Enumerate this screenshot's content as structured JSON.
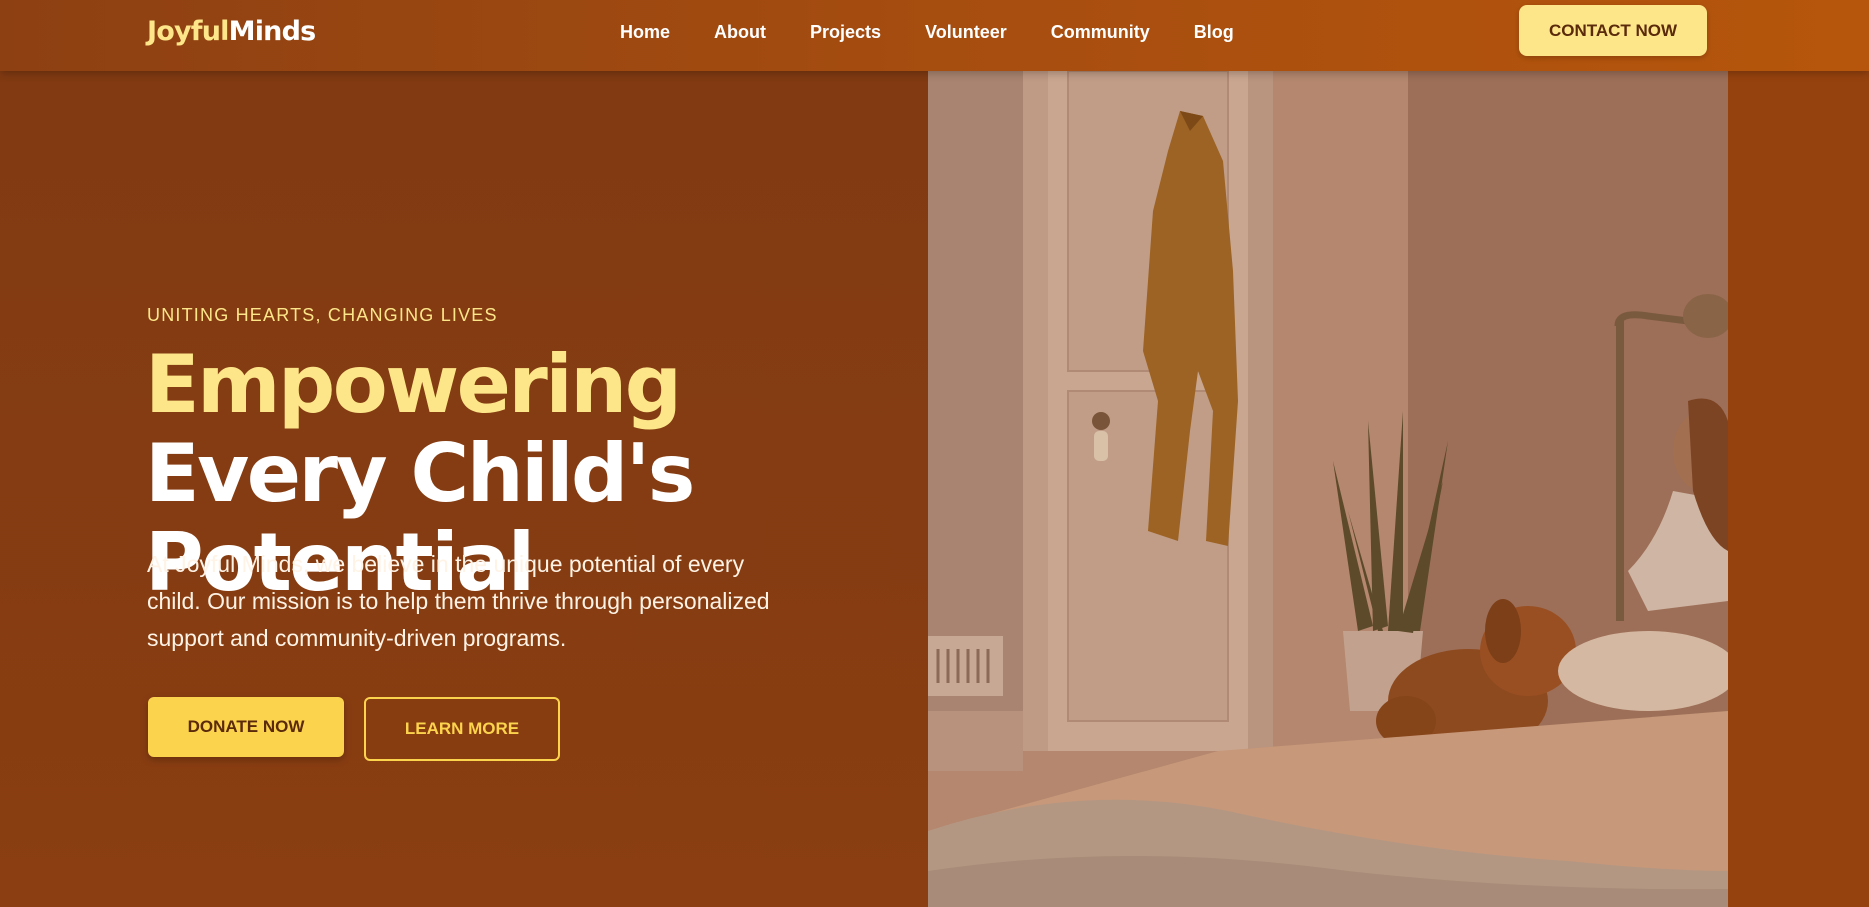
{
  "header": {
    "logo_part1": "Joyful",
    "logo_part2": "Minds",
    "nav": [
      "Home",
      "About",
      "Projects",
      "Volunteer",
      "Community",
      "Blog"
    ],
    "cta_label": "CONTACT NOW"
  },
  "hero": {
    "tagline": "UNITING HEARTS, CHANGING LIVES",
    "headline_highlight": "Empowering",
    "headline_rest": " Every Child's Potential",
    "description": "At Joyful Minds, we believe in the unique potential of every child. Our mission is to help them thrive through personalized support and community-driven programs.",
    "donate_label": "DONATE NOW",
    "learn_label": "LEARN MORE"
  },
  "colors": {
    "brand_yellow": "#fde68a",
    "button_yellow": "#fcd34d",
    "hero_bg": "#8a3e11",
    "nav_bg": "#a64d10"
  }
}
